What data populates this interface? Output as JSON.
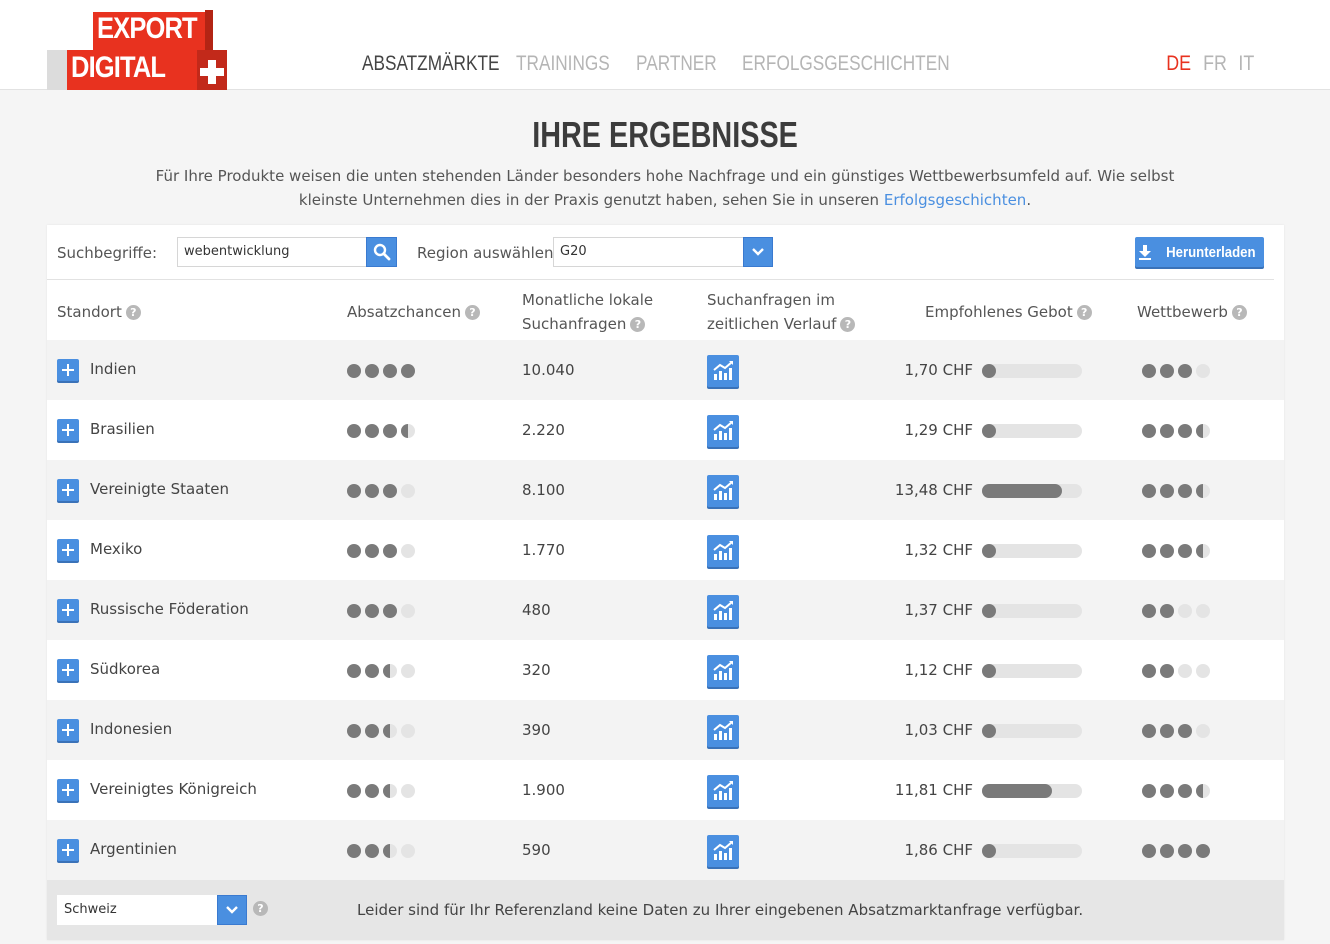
{
  "header": {
    "logo_top": "EXPORT",
    "logo_bottom": "DIGITAL",
    "nav": [
      "ABSATZMÄRKTE",
      "TRAININGS",
      "PARTNER",
      "ERFOLGSGESCHICHTEN"
    ],
    "nav_active": "ABSATZMÄRKTE",
    "languages": [
      "DE",
      "FR",
      "IT"
    ],
    "language_active": "DE"
  },
  "intro": {
    "title": "IHRE ERGEBNISSE",
    "text": "Für Ihre Produkte weisen die unten stehenden Länder besonders hohe Nachfrage und ein günstiges Wettbewerbsumfeld auf. Wie selbst kleinste Unternehmen dies in der Praxis genutzt haben, sehen Sie in unseren ",
    "link": "Erfolgsgeschichten",
    "text_end": "."
  },
  "search": {
    "label": "Suchbegriffe:",
    "value": "webentwicklung",
    "region_label": "Region auswählen:",
    "region_value": "G20",
    "download_label": "Herunterladen"
  },
  "table": {
    "headers": {
      "location": "Standort",
      "chances": "Absatzchancen",
      "searches_line1": "Monatliche lokale",
      "searches_line2": "Suchanfragen",
      "trend_line1": "Suchanfragen im",
      "trend_line2": "zeitlichen Verlauf",
      "bid": "Empfohlenes Gebot",
      "competition": "Wettbewerb"
    },
    "help_icon": "?",
    "rows": [
      {
        "country": "Indien",
        "chances": 4,
        "searches": "10.040",
        "bid": "1,70 CHF",
        "bid_level": 0.02,
        "competition": 3
      },
      {
        "country": "Brasilien",
        "chances": 3.5,
        "searches": "2.220",
        "bid": "1,29 CHF",
        "bid_level": 0.02,
        "competition": 3.5
      },
      {
        "country": "Vereinigte Staaten",
        "chances": 3,
        "searches": "8.100",
        "bid": "13,48 CHF",
        "bid_level": 0.8,
        "competition": 3.5
      },
      {
        "country": "Mexiko",
        "chances": 3,
        "searches": "1.770",
        "bid": "1,32 CHF",
        "bid_level": 0.02,
        "competition": 3.5
      },
      {
        "country": "Russische Föderation",
        "chances": 3,
        "searches": "480",
        "bid": "1,37 CHF",
        "bid_level": 0.02,
        "competition": 2
      },
      {
        "country": "Südkorea",
        "chances": 2.5,
        "searches": "320",
        "bid": "1,12 CHF",
        "bid_level": 0.02,
        "competition": 2
      },
      {
        "country": "Indonesien",
        "chances": 2.5,
        "searches": "390",
        "bid": "1,03 CHF",
        "bid_level": 0.02,
        "competition": 3
      },
      {
        "country": "Vereinigtes Königreich",
        "chances": 2.5,
        "searches": "1.900",
        "bid": "11,81 CHF",
        "bid_level": 0.7,
        "competition": 3.5
      },
      {
        "country": "Argentinien",
        "chances": 2.5,
        "searches": "590",
        "bid": "1,86 CHF",
        "bid_level": 0.02,
        "competition": 4
      }
    ]
  },
  "footer": {
    "reference_country": "Schweiz",
    "note": "Leider sind für Ihr Referenzland keine Daten zu Ihrer eingebenen Absatzmarktanfrage verfügbar."
  },
  "colors": {
    "accent": "#4a8fe0",
    "brand_red": "#e8321f",
    "dot_full": "#7a7a7a",
    "dot_empty": "#e4e4e4"
  }
}
